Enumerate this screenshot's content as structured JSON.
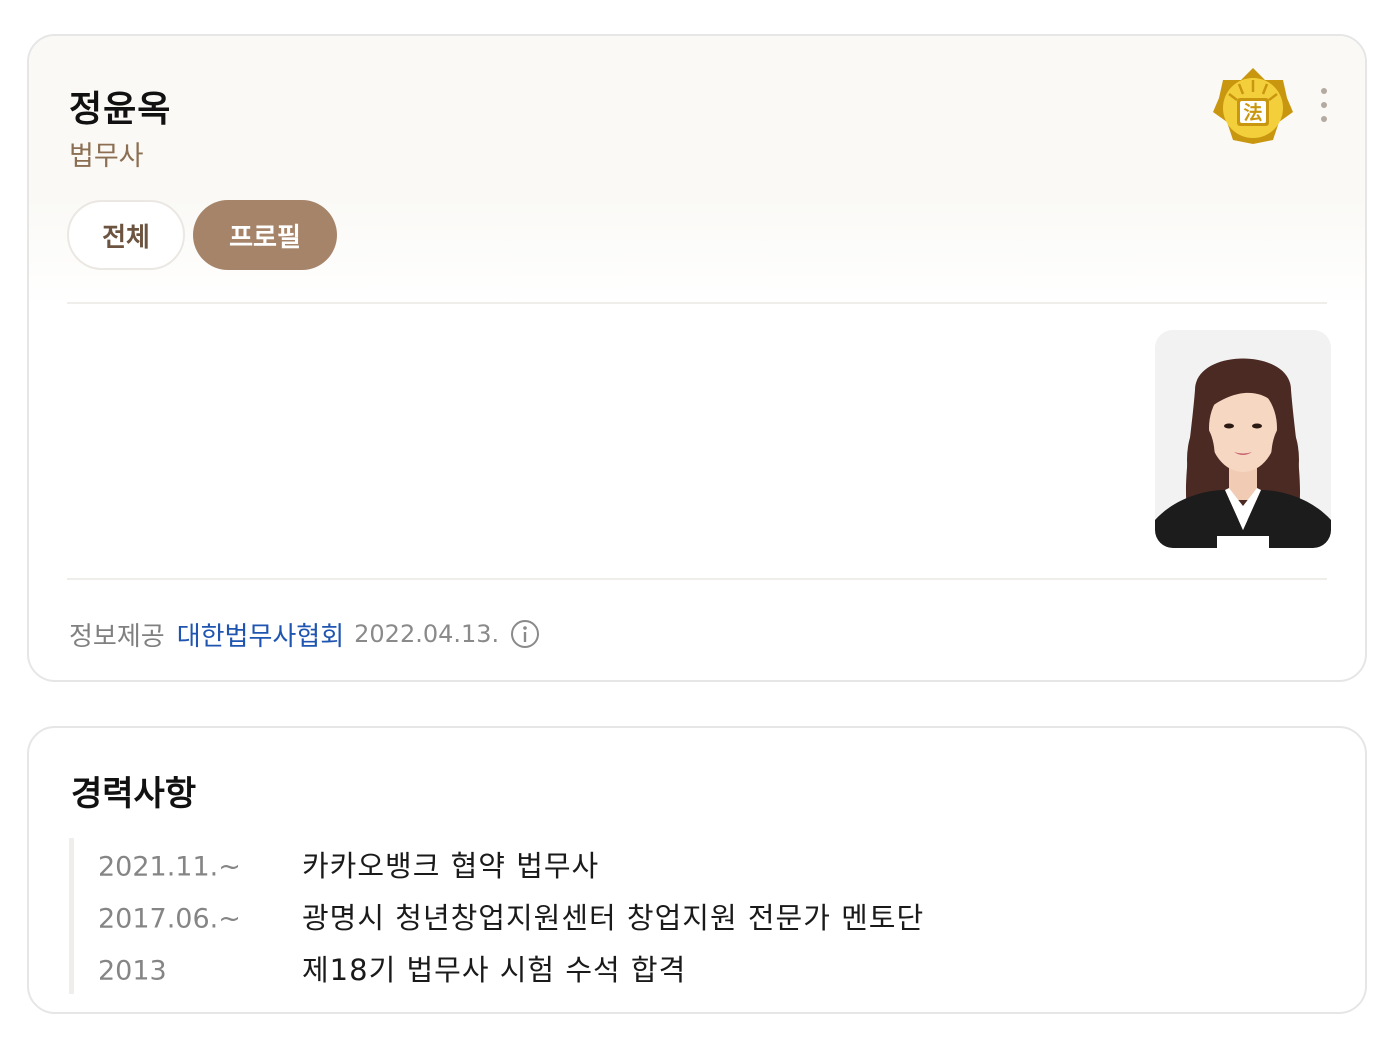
{
  "profile": {
    "name": "정윤옥",
    "job": "법무사",
    "emblem_icon": "court-emblem-icon",
    "emblem_text": "法",
    "more_icon": "more-vertical-icon",
    "tabs": [
      {
        "label": "전체",
        "active": false
      },
      {
        "label": "프로필",
        "active": true
      }
    ],
    "photo_icon": "portrait-photo",
    "source": {
      "label": "정보제공",
      "org": "대한법무사협회",
      "date": "2022.04.13.",
      "info_icon": "info-icon"
    }
  },
  "career": {
    "title": "경력사항",
    "items": [
      {
        "date": "2021.11.~",
        "description": "카카오뱅크 협약 법무사"
      },
      {
        "date": "2017.06.~",
        "description": "광명시 청년창업지원센터 창업지원 전문가 멘토단"
      },
      {
        "date": "2013",
        "description": "제18기 법무사 시험 수석 합격"
      }
    ]
  },
  "colors": {
    "accent": "#a6846a",
    "job_text": "#8c6f53",
    "link": "#1f55b0",
    "emblem": "#c9970f"
  }
}
